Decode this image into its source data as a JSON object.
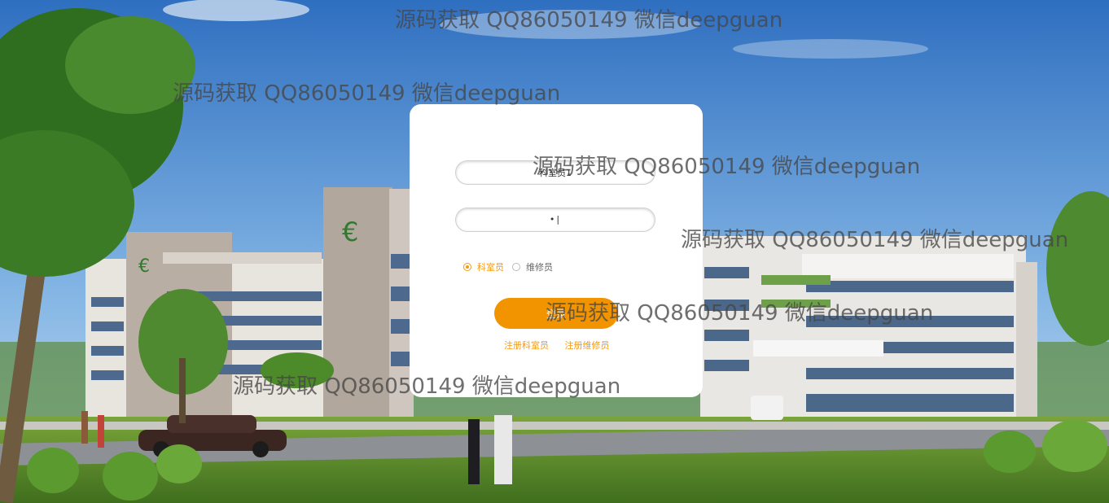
{
  "login_form": {
    "username_value": "科室员1",
    "password_value": "•|",
    "roles": [
      {
        "label": "科室员",
        "selected": true
      },
      {
        "label": "维修员",
        "selected": false
      }
    ],
    "login_button_label": "登录",
    "register_links": [
      "注册科室员",
      "注册维修员"
    ]
  },
  "watermark_text": "源码获取 QQ86050149 微信deepguan",
  "colors": {
    "accent": "#f29400",
    "card_bg": "#ffffff",
    "sky_top": "#3a7ac8",
    "sky_bottom": "#b7d7ef",
    "grass": "#5f8f2e"
  }
}
